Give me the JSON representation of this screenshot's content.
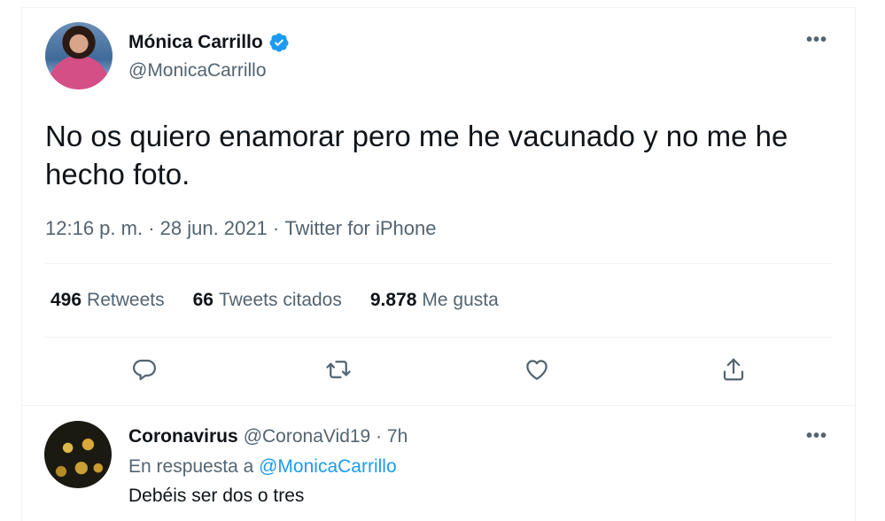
{
  "tweet": {
    "display_name": "Mónica Carrillo",
    "handle": "@MonicaCarrillo",
    "text": "No os quiero enamorar pero me he vacunado y no me he hecho foto.",
    "time": "12:16 p. m.",
    "date": "28 jun. 2021",
    "source": "Twitter for iPhone",
    "separator": " · ",
    "verified_icon": "verified-badge-icon",
    "more_icon": "more-icon",
    "more_label": "•••"
  },
  "stats": [
    {
      "count": "496",
      "label": "Retweets"
    },
    {
      "count": "66",
      "label": "Tweets citados"
    },
    {
      "count": "9.878",
      "label": "Me gusta"
    }
  ],
  "actions": [
    {
      "icon": "reply-icon"
    },
    {
      "icon": "retweet-icon"
    },
    {
      "icon": "like-icon"
    },
    {
      "icon": "share-icon"
    }
  ],
  "reply": {
    "display_name": "Coronavirus",
    "handle": "@CoronaVid19",
    "separator": " · ",
    "time": "7h",
    "in_reply_prefix": "En respuesta a",
    "in_reply_handle": "@MonicaCarrillo",
    "text": "Debéis ser dos o tres"
  },
  "colors": {
    "accent": "#1d9bf0",
    "secondary_text": "#536471",
    "primary_text": "#0f1419",
    "divider": "#eff3f4"
  }
}
